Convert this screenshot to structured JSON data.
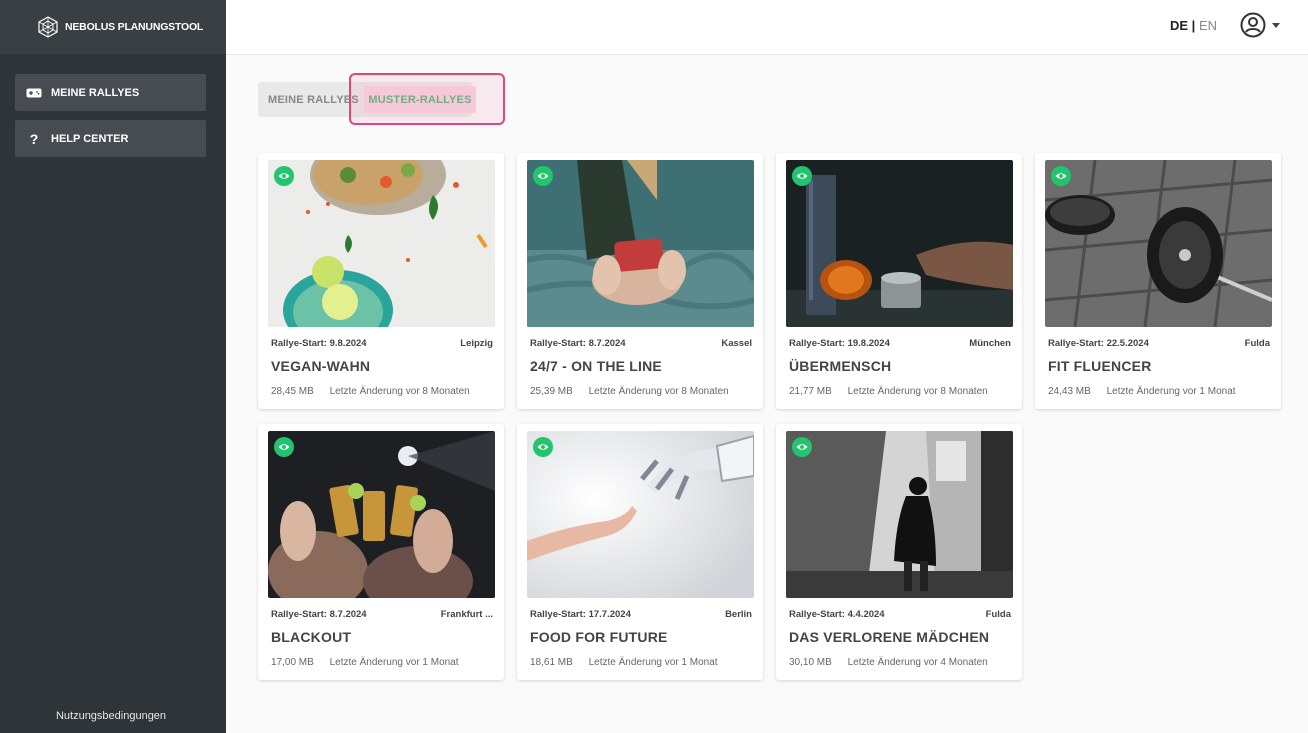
{
  "brand": {
    "name": "NEBOLUS PLANUNGSTOOL"
  },
  "sidebar": {
    "items": [
      {
        "label": "MEINE RALLYES",
        "icon": "gamepad-icon"
      },
      {
        "label": "HELP CENTER",
        "icon": "question-icon"
      }
    ],
    "footer": "Nutzungsbedingungen"
  },
  "topbar": {
    "lang_de": "DE",
    "lang_sep": "|",
    "lang_en": "EN"
  },
  "tabs": {
    "mine": "MEINE RALLYES",
    "muster": "MUSTER-RALLYES"
  },
  "colors": {
    "accent": "#61b88a",
    "eye_badge": "#23c46e",
    "sidebar": "#2f3438",
    "highlight": "#e0457c"
  },
  "cards": [
    {
      "start": "Rallye-Start: 9.8.2024",
      "city": "Leipzig",
      "title": "VEGAN-WAHN",
      "size": "28,45 MB",
      "changed": "Letzte Änderung vor 8 Monaten"
    },
    {
      "start": "Rallye-Start: 8.7.2024",
      "city": "Kassel",
      "title": "24/7 - ON THE LINE",
      "size": "25,39 MB",
      "changed": "Letzte Änderung vor 8 Monaten"
    },
    {
      "start": "Rallye-Start: 19.8.2024",
      "city": "München",
      "title": "ÜBERMENSCH",
      "size": "21,77 MB",
      "changed": "Letzte Änderung vor 8 Monaten"
    },
    {
      "start": "Rallye-Start: 22.5.2024",
      "city": "Fulda",
      "title": "FIT FLUENCER",
      "size": "24,43 MB",
      "changed": "Letzte Änderung vor 1 Monat"
    },
    {
      "start": "Rallye-Start: 8.7.2024",
      "city": "Frankfurt ...",
      "title": "BLACKOUT",
      "size": "17,00 MB",
      "changed": "Letzte Änderung vor 1 Monat"
    },
    {
      "start": "Rallye-Start: 17.7.2024",
      "city": "Berlin",
      "title": "FOOD FOR FUTURE",
      "size": "18,61 MB",
      "changed": "Letzte Änderung vor 1 Monat"
    },
    {
      "start": "Rallye-Start: 4.4.2024",
      "city": "Fulda",
      "title": "DAS VERLORENE MÄDCHEN",
      "size": "30,10 MB",
      "changed": "Letzte Änderung vor 4 Monaten"
    }
  ]
}
